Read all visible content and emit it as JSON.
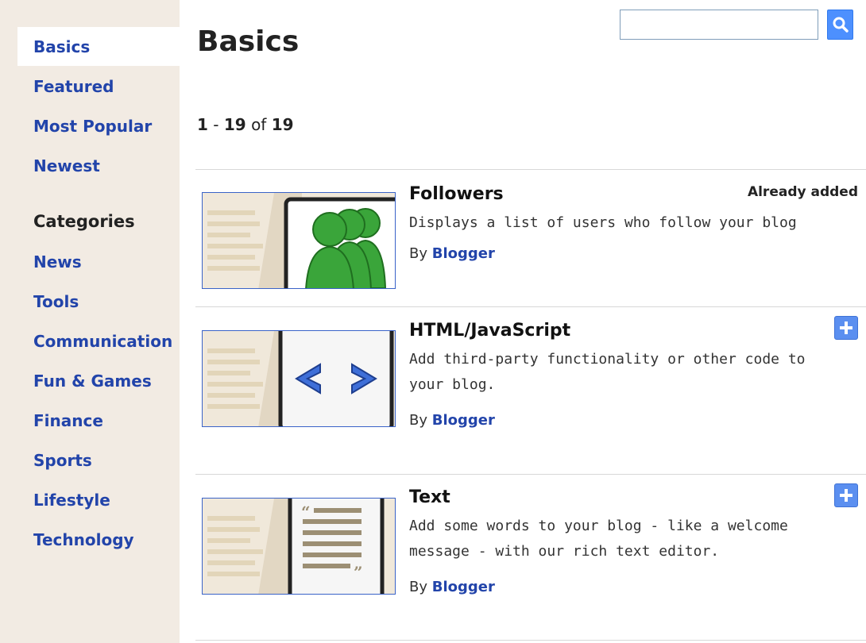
{
  "sidebar": {
    "active": "Basics",
    "items": [
      {
        "label": "Basics"
      },
      {
        "label": "Featured"
      },
      {
        "label": "Most Popular"
      },
      {
        "label": "Newest"
      }
    ],
    "categories_heading": "Categories",
    "categories": [
      {
        "label": "News"
      },
      {
        "label": "Tools"
      },
      {
        "label": "Communication"
      },
      {
        "label": "Fun & Games"
      },
      {
        "label": "Finance"
      },
      {
        "label": "Sports"
      },
      {
        "label": "Lifestyle"
      },
      {
        "label": "Technology"
      }
    ]
  },
  "main": {
    "title": "Basics",
    "search": {
      "value": "",
      "placeholder": ""
    },
    "pager": {
      "start": "1",
      "end": "19",
      "of_label": "of",
      "total": "19"
    },
    "gadgets": [
      {
        "title": "Followers",
        "description": "Displays a list of users who follow your blog",
        "by_label": "By",
        "author": "Blogger",
        "status": "Already added",
        "icon": "followers-icon"
      },
      {
        "title": "HTML/JavaScript",
        "description": "Add third-party functionality or other code to your blog.",
        "by_label": "By",
        "author": "Blogger",
        "icon": "code-icon"
      },
      {
        "title": "Text",
        "description": "Add some words to your blog - like a welcome message - with our rich text editor.",
        "by_label": "By",
        "author": "Blogger",
        "icon": "text-document-icon"
      }
    ]
  },
  "colors": {
    "link": "#2244aa",
    "sidebar_bg": "#f2ebe3",
    "accent": "#4d90fe"
  }
}
